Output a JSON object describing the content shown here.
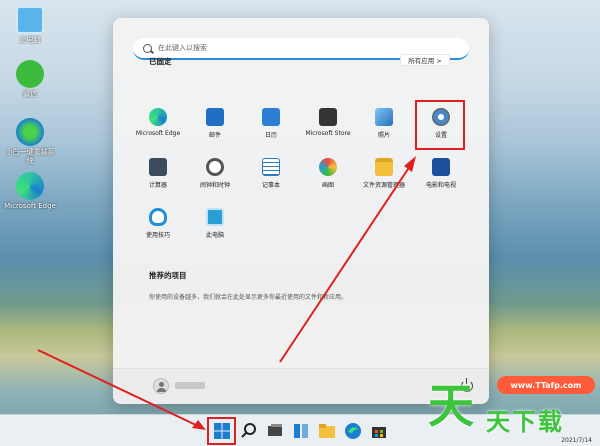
{
  "desktop": {
    "icons": [
      {
        "label": "此电脑"
      },
      {
        "label": "微信"
      },
      {
        "label": "小白一键重装系统"
      },
      {
        "label": "Microsoft Edge"
      }
    ]
  },
  "start_menu": {
    "search_placeholder": "在此键入以搜索",
    "pinned_title": "已固定",
    "all_apps_label": "所有应用  >",
    "apps": [
      {
        "name": "Microsoft Edge",
        "color": "#1f8fd8"
      },
      {
        "name": "邮件",
        "color": "#1f6fc4"
      },
      {
        "name": "日历",
        "color": "#2b7fd3"
      },
      {
        "name": "Microsoft Store",
        "color": "#333333"
      },
      {
        "name": "照片",
        "color": "#3a86c8"
      },
      {
        "name": "设置",
        "color": "#5a6a78"
      },
      {
        "name": "计算器",
        "color": "#3b4c5c"
      },
      {
        "name": "闹钟和时钟",
        "color": "#555555"
      },
      {
        "name": "记事本",
        "color": "#2f7bbf"
      },
      {
        "name": "画图",
        "color": "#3aa0a0"
      },
      {
        "name": "文件资源管理器",
        "color": "#f2c03c"
      },
      {
        "name": "电影和电视",
        "color": "#1d4f9e"
      },
      {
        "name": "使用技巧",
        "color": "#1f8fd8"
      },
      {
        "name": "此电脑",
        "color": "#2a9fd6"
      }
    ],
    "recommended_title": "推荐的项目",
    "recommended_text": "你使用的设备越多，我们就会在此处显示更多你最近使用的文件和新应用。"
  },
  "watermark": {
    "site": "www.TTafp.com",
    "big_char": "天",
    "small_text": "天下载"
  },
  "clock": {
    "date": "2021/7/14"
  }
}
